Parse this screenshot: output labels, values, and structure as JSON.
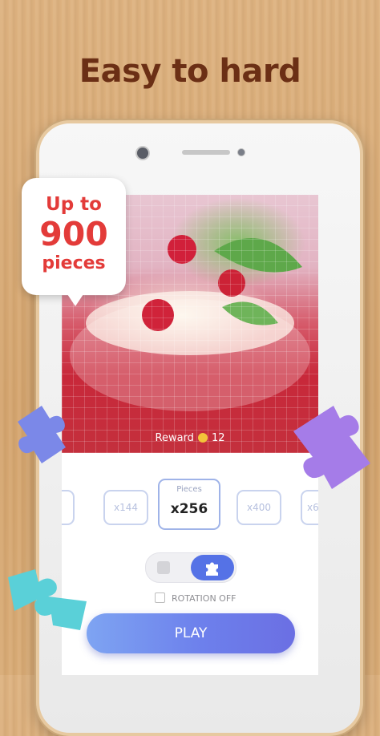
{
  "headline": "Easy to hard",
  "callout": {
    "line1": "Up to",
    "line2": "900",
    "line3": "pieces"
  },
  "puzzle": {
    "reward_label": "Reward",
    "reward_value": "12"
  },
  "pieces_selector": {
    "caption": "Pieces",
    "options": [
      {
        "label": "x144"
      },
      {
        "label": "x256",
        "selected": true
      },
      {
        "label": "x400"
      },
      {
        "label": "x6"
      }
    ]
  },
  "rotation": {
    "label": "ROTATION OFF"
  },
  "play_button": {
    "label": "PLAY"
  },
  "colors": {
    "headline": "#6b2f15",
    "callout": "#e33b39",
    "play_start": "#7ea4f2",
    "play_end": "#6b6fe3",
    "toggle_active": "#5572e6",
    "deco_blue": "#7b88e8",
    "deco_purple": "#a57ce8",
    "deco_teal": "#5ad0d8"
  },
  "icons": [
    "puzzle-piece-icon",
    "square-icon",
    "coin-icon",
    "checkbox-icon"
  ]
}
